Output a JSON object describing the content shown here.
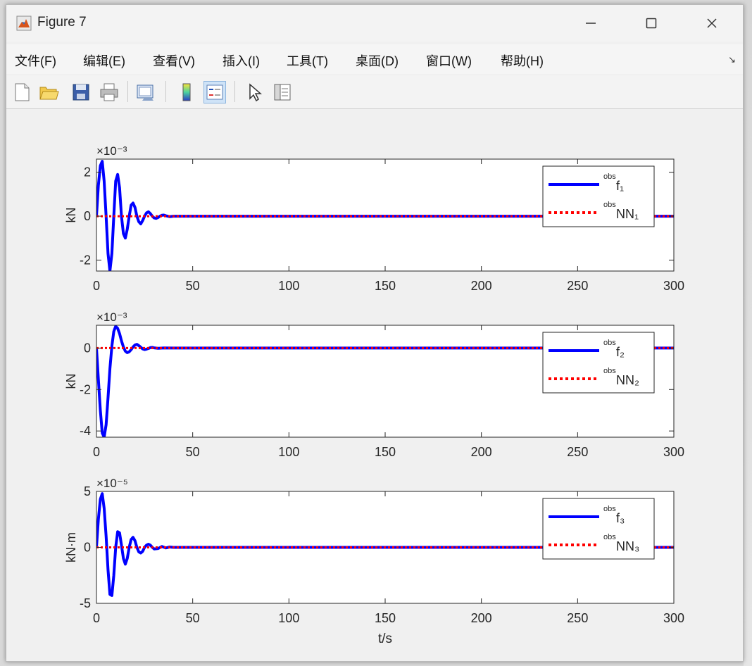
{
  "window": {
    "title": "Figure 7",
    "icon": "matlab-figure-icon"
  },
  "menu": {
    "items": [
      "文件(F)",
      "编辑(E)",
      "查看(V)",
      "插入(I)",
      "工具(T)",
      "桌面(D)",
      "窗口(W)",
      "帮助(H)"
    ]
  },
  "toolbar": {
    "buttons": [
      {
        "icon": "new-figure-icon"
      },
      {
        "icon": "open-file-icon"
      },
      {
        "icon": "save-icon"
      },
      {
        "icon": "print-icon"
      },
      {
        "icon": "link-plot-icon"
      },
      {
        "icon": "colorbar-icon"
      },
      {
        "icon": "legend-icon",
        "pressed": true
      },
      {
        "icon": "edit-plot-icon"
      },
      {
        "icon": "property-inspector-icon"
      }
    ]
  },
  "chart_data": [
    {
      "type": "line",
      "x_range": [
        0,
        300
      ],
      "ylim": [
        -2.5,
        2.6
      ],
      "exponent_label": "×10⁻³",
      "ylabel": "kN",
      "xlabel": "",
      "xticks": [
        0,
        50,
        100,
        150,
        200,
        250,
        300
      ],
      "yticks": [
        -2,
        0,
        2
      ],
      "legend": "top-right",
      "series": [
        {
          "name": "f₁",
          "name_sup": "obs",
          "color": "#0000ff",
          "style": "solid",
          "x": [
            0,
            1,
            2,
            3,
            4,
            5,
            6,
            7,
            8,
            9,
            10,
            11,
            12,
            13,
            14,
            15,
            16,
            17,
            18,
            19,
            20,
            21,
            22,
            23,
            24,
            25,
            26,
            27,
            28,
            29,
            30,
            31,
            32,
            33,
            34,
            35,
            36,
            37,
            38,
            40,
            45,
            50,
            300
          ],
          "y": [
            0,
            1.4,
            2.3,
            2.5,
            1.6,
            0,
            -1.7,
            -2.5,
            -1.7,
            0,
            1.6,
            1.9,
            1.3,
            0,
            -0.8,
            -1.0,
            -0.6,
            0,
            0.5,
            0.6,
            0.4,
            0,
            -0.25,
            -0.35,
            -0.2,
            0,
            0.15,
            0.2,
            0.12,
            0,
            -0.08,
            -0.1,
            -0.06,
            0,
            0.04,
            0.05,
            0.02,
            0,
            -0.02,
            0,
            0,
            0,
            0
          ]
        },
        {
          "name": "NN₁",
          "name_sup": "obs",
          "color": "#ff0000",
          "style": "dotted",
          "x": [
            0,
            300
          ],
          "y": [
            0,
            0
          ]
        }
      ]
    },
    {
      "type": "line",
      "x_range": [
        0,
        300
      ],
      "ylim": [
        -4.3,
        1.1
      ],
      "exponent_label": "×10⁻³",
      "ylabel": "kN",
      "xlabel": "",
      "xticks": [
        0,
        50,
        100,
        150,
        200,
        250,
        300
      ],
      "yticks": [
        -4,
        -2,
        0
      ],
      "legend": "top-right",
      "series": [
        {
          "name": "f₂",
          "name_sup": "obs",
          "color": "#0000ff",
          "style": "solid",
          "x": [
            0,
            1,
            2,
            3,
            4,
            5,
            6,
            7,
            8,
            9,
            10,
            11,
            12,
            13,
            14,
            15,
            16,
            17,
            18,
            19,
            20,
            21,
            22,
            23,
            24,
            25,
            26,
            27,
            28,
            29,
            30,
            32,
            35,
            40,
            50,
            300
          ],
          "y": [
            0,
            -1.5,
            -3,
            -4.1,
            -4.3,
            -3.7,
            -2.4,
            -1,
            0.1,
            0.8,
            1.05,
            0.95,
            0.7,
            0.35,
            0.05,
            -0.15,
            -0.22,
            -0.18,
            -0.08,
            0.05,
            0.15,
            0.18,
            0.12,
            0.04,
            -0.04,
            -0.07,
            -0.05,
            -0.02,
            0.02,
            0.03,
            0.01,
            -0.01,
            0.005,
            0,
            0,
            0
          ]
        },
        {
          "name": "NN₂",
          "name_sup": "obs",
          "color": "#ff0000",
          "style": "dotted",
          "x": [
            0,
            300
          ],
          "y": [
            0,
            0
          ]
        }
      ]
    },
    {
      "type": "line",
      "x_range": [
        0,
        300
      ],
      "ylim": [
        -5,
        5
      ],
      "exponent_label": "×10⁻⁵",
      "ylabel": "kN·m",
      "xlabel": "t/s",
      "xticks": [
        0,
        50,
        100,
        150,
        200,
        250,
        300
      ],
      "yticks": [
        -5,
        0,
        5
      ],
      "legend": "top-right",
      "series": [
        {
          "name": "f₃",
          "name_sup": "obs",
          "color": "#0000ff",
          "style": "solid",
          "x": [
            0,
            1,
            2,
            3,
            4,
            5,
            6,
            7,
            8,
            9,
            10,
            11,
            12,
            13,
            14,
            15,
            16,
            17,
            18,
            19,
            20,
            21,
            22,
            23,
            24,
            25,
            26,
            27,
            28,
            29,
            30,
            32,
            34,
            36,
            38,
            40,
            45,
            50,
            300
          ],
          "y": [
            0,
            2.5,
            4.3,
            4.8,
            3.5,
            1.0,
            -2.0,
            -4.2,
            -4.3,
            -2.5,
            0,
            1.4,
            1.3,
            0.2,
            -1.0,
            -1.5,
            -1.0,
            0,
            0.7,
            0.9,
            0.6,
            0,
            -0.4,
            -0.5,
            -0.35,
            0,
            0.2,
            0.28,
            0.2,
            0,
            -0.14,
            -0.1,
            0.08,
            -0.05,
            0.03,
            0,
            0,
            0,
            0
          ]
        },
        {
          "name": "NN₃",
          "name_sup": "obs",
          "color": "#ff0000",
          "style": "dotted",
          "x": [
            0,
            300
          ],
          "y": [
            0,
            0
          ]
        }
      ]
    }
  ]
}
